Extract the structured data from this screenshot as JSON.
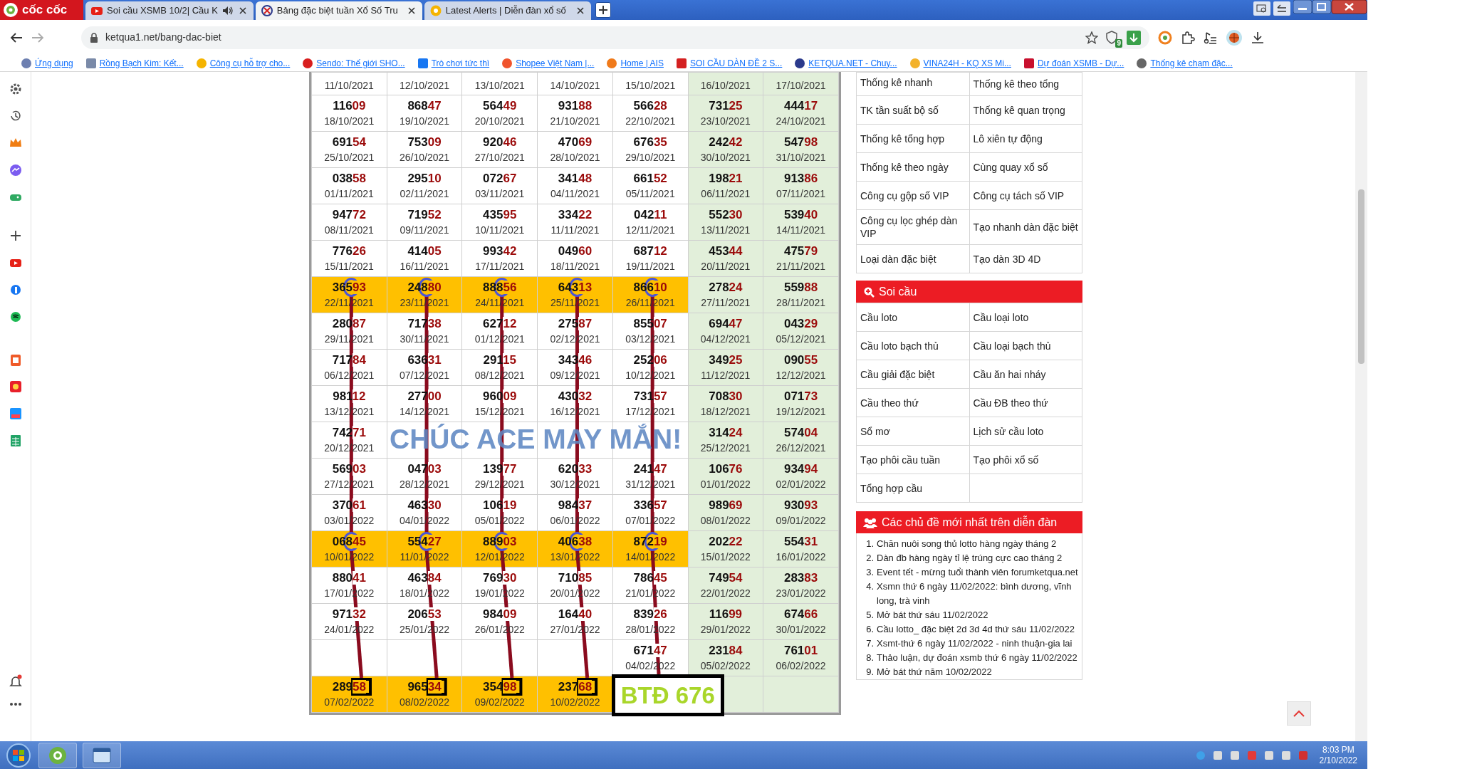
{
  "browser": {
    "logo": "cốc cốc",
    "tabs": [
      {
        "title": "Soi cầu XSMB 10/2| Cầu K",
        "selected": false,
        "audio": true
      },
      {
        "title": "Bảng đặc biệt tuần Xổ Số Tru",
        "selected": true,
        "audio": false
      },
      {
        "title": "Latest Alerts | Diễn đàn xổ số",
        "selected": false,
        "audio": false
      }
    ],
    "address": "ketqua1.net/bang-dac-biet",
    "extension_badge": "9",
    "bookmarks": [
      "Ứng dụng",
      "Rồng Bạch Kim: Kết...",
      "Công cụ hỗ trợ cho...",
      "Sendo: Thế giới SHO...",
      "Trò chơi tức thì",
      "Shopee Việt Nam |...",
      "Home | AIS",
      "SOI CẦU DÀN ĐỀ 2 S...",
      "KETQUA.NET - Chuy...",
      "VINA24H - KQ XS Mi...",
      "Dự đoán XSMB - Dự...",
      "Thống kê chạm đặc..."
    ]
  },
  "table": {
    "banner": "CHÚC ACE MAY MẮN!",
    "rows": [
      {
        "cells": [
          {
            "date": "11/10/2021",
            "highlight": false,
            "weekend": false
          },
          {
            "date": "12/10/2021",
            "highlight": false,
            "weekend": false
          },
          {
            "date": "13/10/2021",
            "highlight": false,
            "weekend": false
          },
          {
            "date": "14/10/2021",
            "highlight": false,
            "weekend": false
          },
          {
            "date": "15/10/2021",
            "highlight": false,
            "weekend": false
          },
          {
            "date": "16/10/2021",
            "highlight": false,
            "weekend": true
          },
          {
            "date": "17/10/2021",
            "highlight": false,
            "weekend": true
          }
        ]
      },
      {
        "cells": [
          {
            "number": "11609",
            "date": "18/10/2021",
            "highlight": false,
            "weekend": false,
            "circled": false,
            "boxed": false
          },
          {
            "number": "86847",
            "date": "19/10/2021",
            "highlight": false,
            "weekend": false,
            "circled": false,
            "boxed": false
          },
          {
            "number": "56449",
            "date": "20/10/2021",
            "highlight": false,
            "weekend": false,
            "circled": false,
            "boxed": false
          },
          {
            "number": "93188",
            "date": "21/10/2021",
            "highlight": false,
            "weekend": false,
            "circled": false,
            "boxed": false
          },
          {
            "number": "56628",
            "date": "22/10/2021",
            "highlight": false,
            "weekend": false,
            "circled": false,
            "boxed": false
          },
          {
            "number": "73125",
            "date": "23/10/2021",
            "highlight": false,
            "weekend": true,
            "circled": false,
            "boxed": false
          },
          {
            "number": "44417",
            "date": "24/10/2021",
            "highlight": false,
            "weekend": true,
            "circled": false,
            "boxed": false
          }
        ]
      },
      {
        "cells": [
          {
            "number": "69154",
            "date": "25/10/2021",
            "highlight": false,
            "weekend": false,
            "circled": false,
            "boxed": false
          },
          {
            "number": "75309",
            "date": "26/10/2021",
            "highlight": false,
            "weekend": false,
            "circled": false,
            "boxed": false
          },
          {
            "number": "92046",
            "date": "27/10/2021",
            "highlight": false,
            "weekend": false,
            "circled": false,
            "boxed": false
          },
          {
            "number": "47069",
            "date": "28/10/2021",
            "highlight": false,
            "weekend": false,
            "circled": false,
            "boxed": false
          },
          {
            "number": "67635",
            "date": "29/10/2021",
            "highlight": false,
            "weekend": false,
            "circled": false,
            "boxed": false
          },
          {
            "number": "24242",
            "date": "30/10/2021",
            "highlight": false,
            "weekend": true,
            "circled": false,
            "boxed": false
          },
          {
            "number": "54798",
            "date": "31/10/2021",
            "highlight": false,
            "weekend": true,
            "circled": false,
            "boxed": false
          }
        ]
      },
      {
        "cells": [
          {
            "number": "03858",
            "date": "01/11/2021",
            "highlight": false,
            "weekend": false,
            "circled": false,
            "boxed": false
          },
          {
            "number": "29510",
            "date": "02/11/2021",
            "highlight": false,
            "weekend": false,
            "circled": false,
            "boxed": false
          },
          {
            "number": "07267",
            "date": "03/11/2021",
            "highlight": false,
            "weekend": false,
            "circled": false,
            "boxed": false
          },
          {
            "number": "34148",
            "date": "04/11/2021",
            "highlight": false,
            "weekend": false,
            "circled": false,
            "boxed": false
          },
          {
            "number": "66152",
            "date": "05/11/2021",
            "highlight": false,
            "weekend": false,
            "circled": false,
            "boxed": false
          },
          {
            "number": "19821",
            "date": "06/11/2021",
            "highlight": false,
            "weekend": true,
            "circled": false,
            "boxed": false
          },
          {
            "number": "91386",
            "date": "07/11/2021",
            "highlight": false,
            "weekend": true,
            "circled": false,
            "boxed": false
          }
        ]
      },
      {
        "cells": [
          {
            "number": "94772",
            "date": "08/11/2021",
            "highlight": false,
            "weekend": false,
            "circled": false,
            "boxed": false
          },
          {
            "number": "71952",
            "date": "09/11/2021",
            "highlight": false,
            "weekend": false,
            "circled": false,
            "boxed": false
          },
          {
            "number": "43595",
            "date": "10/11/2021",
            "highlight": false,
            "weekend": false,
            "circled": false,
            "boxed": false
          },
          {
            "number": "33422",
            "date": "11/11/2021",
            "highlight": false,
            "weekend": false,
            "circled": false,
            "boxed": false
          },
          {
            "number": "04211",
            "date": "12/11/2021",
            "highlight": false,
            "weekend": false,
            "circled": false,
            "boxed": false
          },
          {
            "number": "55230",
            "date": "13/11/2021",
            "highlight": false,
            "weekend": true,
            "circled": false,
            "boxed": false
          },
          {
            "number": "53940",
            "date": "14/11/2021",
            "highlight": false,
            "weekend": true,
            "circled": false,
            "boxed": false
          }
        ]
      },
      {
        "cells": [
          {
            "number": "77626",
            "date": "15/11/2021",
            "highlight": false,
            "weekend": false,
            "circled": false,
            "boxed": false
          },
          {
            "number": "41405",
            "date": "16/11/2021",
            "highlight": false,
            "weekend": false,
            "circled": false,
            "boxed": false
          },
          {
            "number": "99342",
            "date": "17/11/2021",
            "highlight": false,
            "weekend": false,
            "circled": false,
            "boxed": false
          },
          {
            "number": "04960",
            "date": "18/11/2021",
            "highlight": false,
            "weekend": false,
            "circled": false,
            "boxed": false
          },
          {
            "number": "68712",
            "date": "19/11/2021",
            "highlight": false,
            "weekend": false,
            "circled": false,
            "boxed": false
          },
          {
            "number": "45344",
            "date": "20/11/2021",
            "highlight": false,
            "weekend": true,
            "circled": false,
            "boxed": false
          },
          {
            "number": "47579",
            "date": "21/11/2021",
            "highlight": false,
            "weekend": true,
            "circled": false,
            "boxed": false
          }
        ]
      },
      {
        "cells": [
          {
            "number": "36593",
            "date": "22/11/2021",
            "highlight": true,
            "circled": true,
            "boxed": false
          },
          {
            "number": "24880",
            "date": "23/11/2021",
            "highlight": true,
            "circled": true,
            "boxed": false
          },
          {
            "number": "88856",
            "date": "24/11/2021",
            "highlight": true,
            "circled": true,
            "boxed": false
          },
          {
            "number": "64313",
            "date": "25/11/2021",
            "highlight": true,
            "circled": true,
            "boxed": false
          },
          {
            "number": "86610",
            "date": "26/11/2021",
            "highlight": true,
            "circled": true,
            "boxed": false
          },
          {
            "number": "27824",
            "date": "27/11/2021",
            "highlight": false,
            "weekend": true,
            "circled": false,
            "boxed": false
          },
          {
            "number": "55988",
            "date": "28/11/2021",
            "highlight": false,
            "weekend": true,
            "circled": false,
            "boxed": false
          }
        ]
      },
      {
        "cells": [
          {
            "number": "28087",
            "date": "29/11/2021",
            "highlight": false,
            "weekend": false,
            "circled": false,
            "boxed": false
          },
          {
            "number": "71738",
            "date": "30/11/2021",
            "highlight": false,
            "weekend": false,
            "circled": false,
            "boxed": false
          },
          {
            "number": "62712",
            "date": "01/12/2021",
            "highlight": false,
            "weekend": false,
            "circled": false,
            "boxed": false
          },
          {
            "number": "27587",
            "date": "02/12/2021",
            "highlight": false,
            "weekend": false,
            "circled": false,
            "boxed": false
          },
          {
            "number": "85507",
            "date": "03/12/2021",
            "highlight": false,
            "weekend": false,
            "circled": false,
            "boxed": false
          },
          {
            "number": "69447",
            "date": "04/12/2021",
            "highlight": false,
            "weekend": true,
            "circled": false,
            "boxed": false
          },
          {
            "number": "04329",
            "date": "05/12/2021",
            "highlight": false,
            "weekend": true,
            "circled": false,
            "boxed": false
          }
        ]
      },
      {
        "cells": [
          {
            "number": "71784",
            "date": "06/12/2021",
            "highlight": false,
            "weekend": false,
            "circled": false,
            "boxed": false
          },
          {
            "number": "63631",
            "date": "07/12/2021",
            "highlight": false,
            "weekend": false,
            "circled": false,
            "boxed": false
          },
          {
            "number": "29115",
            "date": "08/12/2021",
            "highlight": false,
            "weekend": false,
            "circled": false,
            "boxed": false
          },
          {
            "number": "34346",
            "date": "09/12/2021",
            "highlight": false,
            "weekend": false,
            "circled": false,
            "boxed": false
          },
          {
            "number": "25206",
            "date": "10/12/2021",
            "highlight": false,
            "weekend": false,
            "circled": false,
            "boxed": false
          },
          {
            "number": "34925",
            "date": "11/12/2021",
            "highlight": false,
            "weekend": true,
            "circled": false,
            "boxed": false
          },
          {
            "number": "09055",
            "date": "12/12/2021",
            "highlight": false,
            "weekend": true,
            "circled": false,
            "boxed": false
          }
        ]
      },
      {
        "cells": [
          {
            "number": "98112",
            "date": "13/12/2021",
            "highlight": false,
            "weekend": false,
            "circled": false,
            "boxed": false
          },
          {
            "number": "27700",
            "date": "14/12/2021",
            "highlight": false,
            "weekend": false,
            "circled": false,
            "boxed": false
          },
          {
            "number": "96009",
            "date": "15/12/2021",
            "highlight": false,
            "weekend": false,
            "circled": false,
            "boxed": false
          },
          {
            "number": "43032",
            "date": "16/12/2021",
            "highlight": false,
            "weekend": false,
            "circled": false,
            "boxed": false
          },
          {
            "number": "73157",
            "date": "17/12/2021",
            "highlight": false,
            "weekend": false,
            "circled": false,
            "boxed": false
          },
          {
            "number": "70830",
            "date": "18/12/2021",
            "highlight": false,
            "weekend": true,
            "circled": false,
            "boxed": false
          },
          {
            "number": "07173",
            "date": "19/12/2021",
            "highlight": false,
            "weekend": true,
            "circled": false,
            "boxed": false
          }
        ]
      },
      {
        "cells": [
          {
            "number": "74271",
            "date": "20/12/2021",
            "highlight": false,
            "weekend": false,
            "circled": false,
            "boxed": false
          },
          {
            "highlight": false,
            "weekend": false
          },
          {
            "highlight": false,
            "weekend": false
          },
          {
            "highlight": false,
            "weekend": false
          },
          {
            "highlight": false,
            "weekend": false
          },
          {
            "number": "31424",
            "date": "25/12/2021",
            "highlight": false,
            "weekend": true,
            "circled": false,
            "boxed": false
          },
          {
            "number": "57404",
            "date": "26/12/2021",
            "highlight": false,
            "weekend": true,
            "circled": false,
            "boxed": false
          }
        ]
      },
      {
        "cells": [
          {
            "number": "56903",
            "date": "27/12/2021",
            "highlight": false,
            "weekend": false,
            "circled": false,
            "boxed": false
          },
          {
            "number": "04703",
            "date": "28/12/2021",
            "highlight": false,
            "weekend": false,
            "circled": false,
            "boxed": false
          },
          {
            "number": "13977",
            "date": "29/12/2021",
            "highlight": false,
            "weekend": false,
            "circled": false,
            "boxed": false
          },
          {
            "number": "62033",
            "date": "30/12/2021",
            "highlight": false,
            "weekend": false,
            "circled": false,
            "boxed": false
          },
          {
            "number": "24147",
            "date": "31/12/2021",
            "highlight": false,
            "weekend": false,
            "circled": false,
            "boxed": false
          },
          {
            "number": "10676",
            "date": "01/01/2022",
            "highlight": false,
            "weekend": true,
            "circled": false,
            "boxed": false
          },
          {
            "number": "93494",
            "date": "02/01/2022",
            "highlight": false,
            "weekend": true,
            "circled": false,
            "boxed": false
          }
        ]
      },
      {
        "cells": [
          {
            "number": "37061",
            "date": "03/01/2022",
            "highlight": false,
            "weekend": false,
            "circled": false,
            "boxed": false
          },
          {
            "number": "46330",
            "date": "04/01/2022",
            "highlight": false,
            "weekend": false,
            "circled": false,
            "boxed": false
          },
          {
            "number": "10619",
            "date": "05/01/2022",
            "highlight": false,
            "weekend": false,
            "circled": false,
            "boxed": false
          },
          {
            "number": "98437",
            "date": "06/01/2022",
            "highlight": false,
            "weekend": false,
            "circled": false,
            "boxed": false
          },
          {
            "number": "33657",
            "date": "07/01/2022",
            "highlight": false,
            "weekend": false,
            "circled": false,
            "boxed": false
          },
          {
            "number": "98969",
            "date": "08/01/2022",
            "highlight": false,
            "weekend": true,
            "circled": false,
            "boxed": false
          },
          {
            "number": "93093",
            "date": "09/01/2022",
            "highlight": false,
            "weekend": true,
            "circled": false,
            "boxed": false
          }
        ]
      },
      {
        "cells": [
          {
            "number": "06845",
            "date": "10/01/2022",
            "highlight": true,
            "circled": true,
            "boxed": false
          },
          {
            "number": "55427",
            "date": "11/01/2022",
            "highlight": true,
            "circled": true,
            "boxed": false
          },
          {
            "number": "88903",
            "date": "12/01/2022",
            "highlight": true,
            "circled": true,
            "boxed": false
          },
          {
            "number": "40638",
            "date": "13/01/2022",
            "highlight": true,
            "circled": true,
            "boxed": false
          },
          {
            "number": "87219",
            "date": "14/01/2022",
            "highlight": true,
            "circled": true,
            "boxed": false
          },
          {
            "number": "20222",
            "date": "15/01/2022",
            "highlight": false,
            "weekend": true,
            "circled": false,
            "boxed": false
          },
          {
            "number": "55431",
            "date": "16/01/2022",
            "highlight": false,
            "weekend": true,
            "circled": false,
            "boxed": false
          }
        ]
      },
      {
        "cells": [
          {
            "number": "88041",
            "date": "17/01/2022",
            "highlight": false,
            "weekend": false,
            "circled": false,
            "boxed": false
          },
          {
            "number": "46384",
            "date": "18/01/2022",
            "highlight": false,
            "weekend": false,
            "circled": false,
            "boxed": false
          },
          {
            "number": "76930",
            "date": "19/01/2022",
            "highlight": false,
            "weekend": false,
            "circled": false,
            "boxed": false
          },
          {
            "number": "71085",
            "date": "20/01/2022",
            "highlight": false,
            "weekend": false,
            "circled": false,
            "boxed": false
          },
          {
            "number": "78645",
            "date": "21/01/2022",
            "highlight": false,
            "weekend": false,
            "circled": false,
            "boxed": false
          },
          {
            "number": "74954",
            "date": "22/01/2022",
            "highlight": false,
            "weekend": true,
            "circled": false,
            "boxed": false
          },
          {
            "number": "28383",
            "date": "23/01/2022",
            "highlight": false,
            "weekend": true,
            "circled": false,
            "boxed": false
          }
        ]
      },
      {
        "cells": [
          {
            "number": "97132",
            "date": "24/01/2022",
            "highlight": false,
            "weekend": false,
            "circled": false,
            "boxed": false
          },
          {
            "number": "20653",
            "date": "25/01/2022",
            "highlight": false,
            "weekend": false,
            "circled": false,
            "boxed": false
          },
          {
            "number": "98409",
            "date": "26/01/2022",
            "highlight": false,
            "weekend": false,
            "circled": false,
            "boxed": false
          },
          {
            "number": "16440",
            "date": "27/01/2022",
            "highlight": false,
            "weekend": false,
            "circled": false,
            "boxed": false
          },
          {
            "number": "83926",
            "date": "28/01/2022",
            "highlight": false,
            "weekend": false,
            "circled": false,
            "boxed": false
          },
          {
            "number": "11699",
            "date": "29/01/2022",
            "highlight": false,
            "weekend": true,
            "circled": false,
            "boxed": false
          },
          {
            "number": "67466",
            "date": "30/01/2022",
            "highlight": false,
            "weekend": true,
            "circled": false,
            "boxed": false
          }
        ]
      },
      {
        "cells": [
          {
            "highlight": false,
            "weekend": false
          },
          {
            "highlight": false,
            "weekend": false
          },
          {
            "highlight": false,
            "weekend": false
          },
          {
            "highlight": false,
            "weekend": false
          },
          {
            "number": "67147",
            "date": "04/02/2022",
            "highlight": false,
            "weekend": false,
            "circled": false,
            "boxed": false
          },
          {
            "number": "23184",
            "date": "05/02/2022",
            "highlight": false,
            "weekend": true,
            "circled": false,
            "boxed": false
          },
          {
            "number": "76101",
            "date": "06/02/2022",
            "highlight": false,
            "weekend": true,
            "circled": false,
            "boxed": false
          }
        ]
      },
      {
        "cells": [
          {
            "number": "28958",
            "date": "07/02/2022",
            "highlight": true,
            "circled": false,
            "boxed": true
          },
          {
            "number": "96534",
            "date": "08/02/2022",
            "highlight": true,
            "circled": false,
            "boxed": true
          },
          {
            "number": "35498",
            "date": "09/02/2022",
            "highlight": true,
            "circled": false,
            "boxed": true
          },
          {
            "number": "23768",
            "date": "10/02/2022",
            "highlight": true,
            "circled": false,
            "boxed": true
          },
          {
            "kind": "callout",
            "text": "BTĐ 676"
          },
          {
            "highlight": false,
            "weekend": true
          },
          {
            "highlight": false,
            "weekend": true
          }
        ]
      }
    ]
  },
  "tools": [
    [
      "Thống kê nhanh",
      "Thống kê theo tổng"
    ],
    [
      "TK tần suất bộ số",
      "Thống kê quan trọng"
    ],
    [
      "Thống kê tổng hợp",
      "Lô xiên tự động"
    ],
    [
      "Thống kê theo ngày",
      "Cùng quay xổ số"
    ],
    [
      "Công cụ gộp số VIP",
      "Công cụ tách số VIP"
    ],
    [
      "Công cụ lọc ghép dàn VIP",
      "Tạo nhanh dàn đặc biệt"
    ],
    [
      "Loại dàn đặc biệt",
      "Tạo dàn 3D 4D"
    ]
  ],
  "soi_cau": {
    "title": "Soi cầu",
    "links": [
      [
        "Cầu loto",
        "Cầu loại loto"
      ],
      [
        "Cầu loto bạch thủ",
        "Cầu loại bạch thủ"
      ],
      [
        "Cầu giải đặc biệt",
        "Cầu ăn hai nháy"
      ],
      [
        "Cầu theo thứ",
        "Cầu ĐB theo thứ"
      ],
      [
        "Sổ mơ",
        "Lịch sử cầu loto"
      ],
      [
        "Tạo phôi cầu tuần",
        "Tạo phôi xổ số"
      ],
      [
        "Tổng hợp cầu"
      ]
    ]
  },
  "forum": {
    "title": "Các chủ đề mới nhất trên diễn đàn",
    "topics": [
      {
        "number": "1.",
        "text": "Chăn nuôi song thủ lotto hàng ngày tháng 2"
      },
      {
        "number": "2.",
        "text": "Dàn đb hàng ngày tỉ lệ trúng cực cao tháng 2"
      },
      {
        "number": "3.",
        "text": "Event tết - mừng tuổi thành viên forumketqua.net"
      },
      {
        "number": "4.",
        "text": "Xsmn thứ 6 ngày 11/02/2022: bình dương, vĩnh long, trà vinh"
      },
      {
        "number": "5.",
        "text": "Mở bát thứ sáu 11/02/2022"
      },
      {
        "number": "6.",
        "text": "Cầu lotto_ đặc biệt 2d 3d 4d thứ sáu 11/02/2022"
      },
      {
        "number": "7.",
        "text": "Xsmt-thứ 6 ngày 11/02/2022 - ninh thuận-gia lai"
      },
      {
        "number": "8.",
        "text": "Thảo luận, dự đoán xsmb thứ 6 ngày 11/02/2022"
      },
      {
        "number": "9.",
        "text": "Mở bát thứ năm 10/02/2022"
      }
    ]
  },
  "taskbar": {
    "time": "8:03 PM",
    "date": "2/10/2022"
  }
}
